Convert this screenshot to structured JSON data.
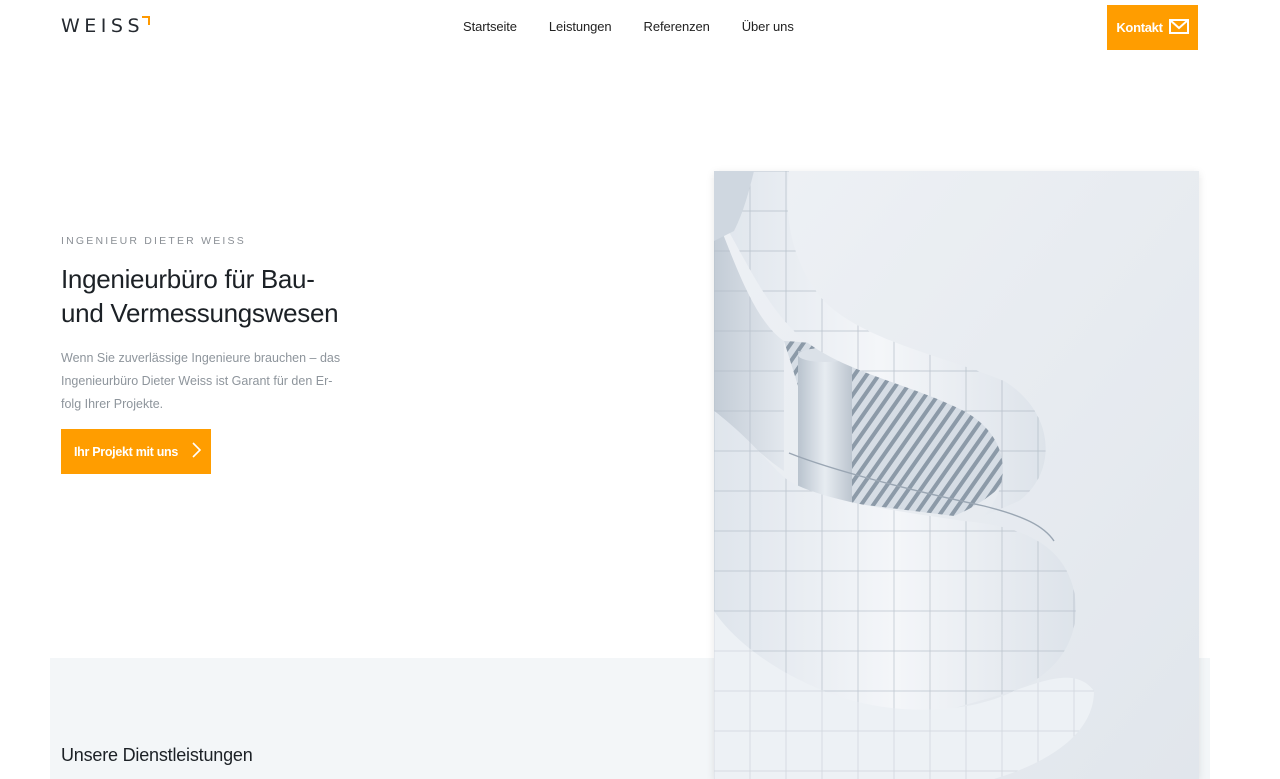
{
  "header": {
    "logo_text": "WEISS",
    "nav": [
      "Startseite",
      "Leistungen",
      "Referenzen",
      "Über uns"
    ],
    "contact_label": "Kontakt"
  },
  "hero": {
    "eyebrow": "INGENIEUR DIETER WEISS",
    "title_lines": [
      "Ingenieurbüro für Bau-",
      "und Vermessungswesen"
    ],
    "text_lines": [
      "Wenn Sie zuverlässige Ingenieure brauchen – das",
      "Ingenieurbüro Dieter Weiss ist Garant für den Er-",
      "folg Ihrer Projekte."
    ],
    "cta_label": "Ihr Projekt mit uns"
  },
  "services": {
    "title": "Unsere Dienstleistungen"
  },
  "colors": {
    "accent": "#ff9d00",
    "band": "#f3f6f8"
  },
  "icons": {
    "contact": "envelope-icon",
    "cta": "chevron-right-icon"
  }
}
